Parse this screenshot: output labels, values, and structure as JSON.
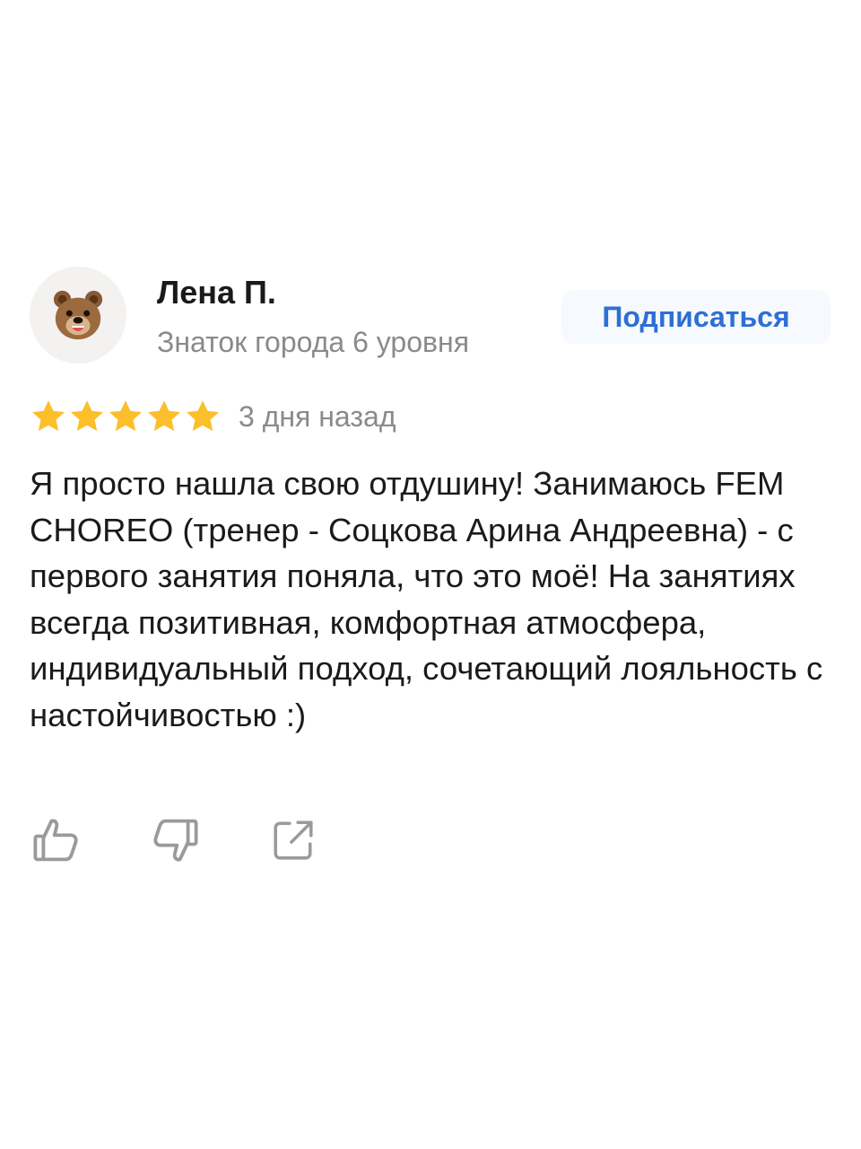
{
  "review": {
    "author": {
      "name": "Лена П.",
      "level": "Знаток города 6 уровня",
      "avatar_icon": "bear-face-icon"
    },
    "subscribe_label": "Подписаться",
    "rating": 5,
    "rating_max": 5,
    "date": "3 дня назад",
    "text": "Я просто нашла свою отдушину! Занимаюсь FEM CHOREO (тренер - Соцкова Арина Андреевна) - с первого занятия поняла, что это моё! На занятиях всегда позитивная, комфортная атмосфера, индивидуальный подход, сочетающий лояльность с настойчивостью :)",
    "actions": {
      "like_icon": "thumbs-up-icon",
      "dislike_icon": "thumbs-down-icon",
      "share_icon": "share-icon"
    }
  },
  "colors": {
    "accent": "#2d6fd6",
    "star": "#fcbf2c",
    "muted_text": "#8a8a8a",
    "text": "#1a1a1a",
    "icon": "#9a9a9a"
  }
}
